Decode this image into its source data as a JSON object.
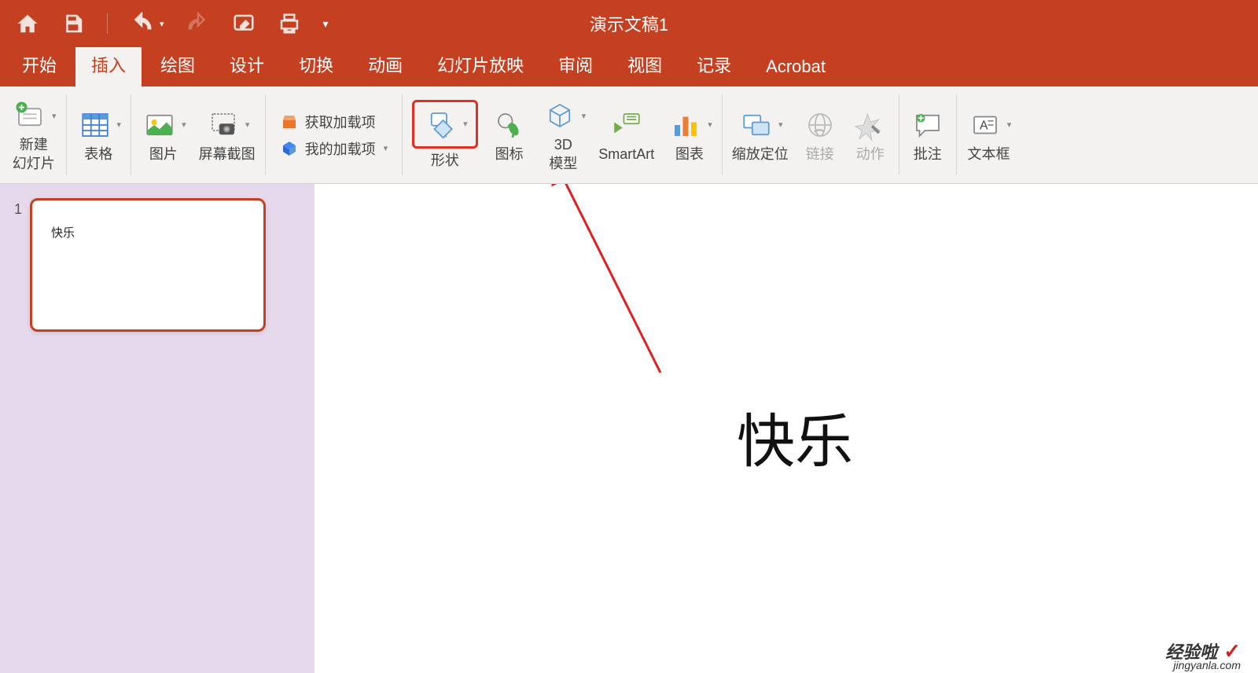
{
  "title": "演示文稿1",
  "tabs": {
    "home": "开始",
    "insert": "插入",
    "draw": "绘图",
    "design": "设计",
    "transition": "切换",
    "animation": "动画",
    "slideshow": "幻灯片放映",
    "review": "审阅",
    "view": "视图",
    "record": "记录",
    "acrobat": "Acrobat"
  },
  "ribbon": {
    "new_slide": "新建\n幻灯片",
    "table": "表格",
    "picture": "图片",
    "screenshot": "屏幕截图",
    "get_addins": "获取加载项",
    "my_addins": "我的加载项",
    "shapes": "形状",
    "icons": "图标",
    "model3d": "3D\n模型",
    "smartart": "SmartArt",
    "chart": "图表",
    "zoom": "缩放定位",
    "link": "链接",
    "action": "动作",
    "comment": "批注",
    "textbox": "文本框"
  },
  "thumbnails": {
    "slide1_num": "1",
    "slide1_text": "快乐"
  },
  "slide": {
    "text": "快乐"
  },
  "watermark": {
    "text": "经验啦",
    "url": "jingyanla.com"
  }
}
